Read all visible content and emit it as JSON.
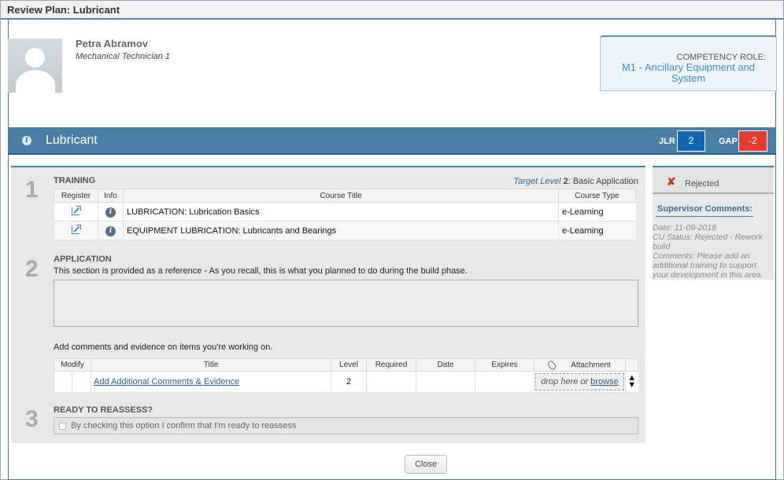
{
  "window": {
    "title": "Review Plan: Lubricant"
  },
  "person": {
    "name": "Petra Abramov",
    "title": "Mechanical Technician 1"
  },
  "role": {
    "label": "COMPETENCY ROLE:",
    "value": "M1 - Ancillary Equipment and System"
  },
  "competency": {
    "name": "Lubricant",
    "jlr_label": "JLR",
    "jlr_value": "2",
    "gap_label": "GAP",
    "gap_value": "-2",
    "colors": {
      "banner": "#4a7fa5",
      "jlr": "#1267b3",
      "gap": "#e53b2e"
    }
  },
  "training": {
    "step": "1",
    "heading": "TRAINING",
    "target_label": "Target Level",
    "target_level": "2",
    "target_name": ": Basic Application",
    "columns": [
      "Register",
      "Info",
      "Course Title",
      "Course Type"
    ],
    "courses": [
      {
        "title": "LUBRICATION: Lubrication Basics",
        "type": "e-Learning"
      },
      {
        "title": "EQUIPMENT LUBRICATION: Lubricants and Bearings",
        "type": "e-Learning"
      }
    ]
  },
  "application": {
    "step": "2",
    "heading": "APPLICATION",
    "description": "This section is provided as a reference - As you recall, this is what you planned to do during the build phase.",
    "text_value": "",
    "evidence_intro": "Add comments and evidence on items you're working on.",
    "columns": [
      "Modify",
      "Title",
      "Level",
      "Required",
      "Date",
      "Expires",
      "Attachment"
    ],
    "row": {
      "title": "Add Additional Comments & Evidence",
      "level": "2",
      "drop_text": "drop here or",
      "browse": "browse"
    }
  },
  "reassess": {
    "step": "3",
    "heading": "READY TO REASSESS?",
    "confirm_text": "By checking this option I confirm that I'm ready to reassess"
  },
  "side": {
    "status": "Rejected",
    "supervisor_heading": "Supervisor Comments:",
    "date": "Date: 11-09-2018",
    "cu_status": "CU Status: Rejected - Rework build",
    "comments": "Comments: Please add an additional training to support your development in this area."
  },
  "footer": {
    "close_label": "Close"
  }
}
